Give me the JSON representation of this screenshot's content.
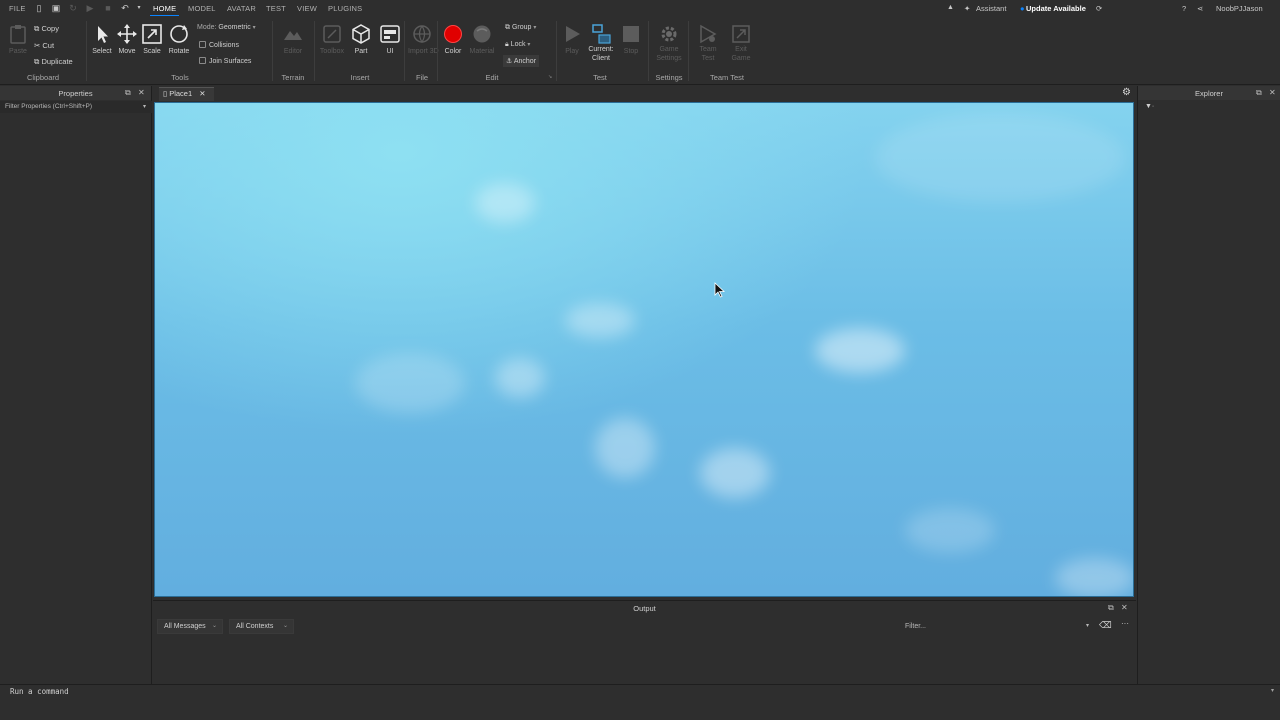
{
  "menu": {
    "file": "FILE",
    "tabs": [
      "HOME",
      "MODEL",
      "AVATAR",
      "TEST",
      "VIEW",
      "PLUGINS"
    ],
    "active_tab": "HOME",
    "assistant": "Assistant",
    "update": "Update Available",
    "username": "NoobPJJason"
  },
  "ribbon": {
    "clipboard": {
      "paste": "Paste",
      "copy": "Copy",
      "cut": "Cut",
      "duplicate": "Duplicate",
      "label": "Clipboard"
    },
    "tools": {
      "select": "Select",
      "move": "Move",
      "scale": "Scale",
      "rotate": "Rotate",
      "mode_label": "Mode:",
      "mode_value": "Geometric",
      "collisions": "Collisions",
      "join_surfaces": "Join Surfaces",
      "label": "Tools"
    },
    "terrain": {
      "editor": "Editor",
      "label": "Terrain"
    },
    "insert": {
      "toolbox": "Toolbox",
      "part": "Part",
      "ui": "UI",
      "label": "Insert"
    },
    "file": {
      "import3d": "Import 3D",
      "label": "File"
    },
    "edit": {
      "color": "Color",
      "material": "Material",
      "group": "Group",
      "lock": "Lock",
      "anchor": "Anchor",
      "label": "Edit"
    },
    "test": {
      "play": "Play",
      "current": "Current:",
      "client": "Client",
      "stop": "Stop",
      "label": "Test"
    },
    "settings": {
      "game_settings_1": "Game",
      "game_settings_2": "Settings",
      "label": "Settings"
    },
    "team_test": {
      "team_1": "Team",
      "team_2": "Test",
      "exit_1": "Exit",
      "exit_2": "Game",
      "label": "Team Test"
    }
  },
  "properties": {
    "title": "Properties",
    "filter": "Filter Properties (Ctrl+Shift+P)"
  },
  "explorer": {
    "title": "Explorer"
  },
  "document": {
    "tab": "Place1"
  },
  "output": {
    "title": "Output",
    "messages": "All Messages",
    "contexts": "All Contexts",
    "filter_placeholder": "Filter..."
  },
  "command": {
    "placeholder": "Run a command"
  },
  "colors": {
    "accent": "#0a84ff",
    "record": "#e00000",
    "sky_top": "#84d3ef",
    "sky_bottom": "#62aedf"
  }
}
